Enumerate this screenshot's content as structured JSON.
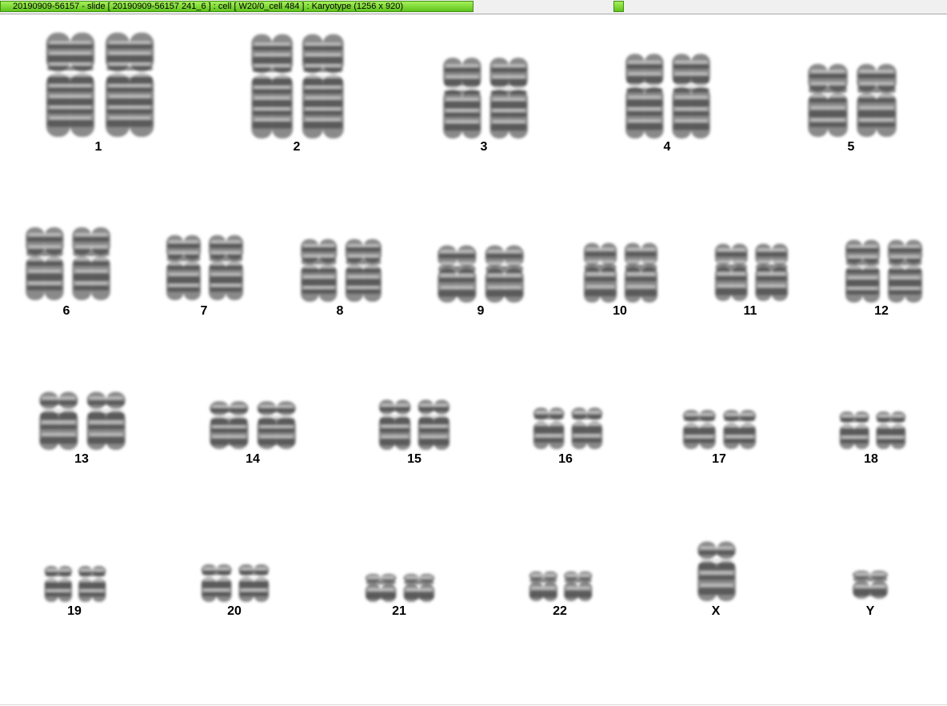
{
  "window": {
    "title": "20190909-56157 - slide [ 20190909-56157 241_6 ] : cell [ W20/0_cell 484 ] : Karyotype  (1256 x 920)"
  },
  "karyotype": {
    "chromosomes": [
      {
        "label": "1"
      },
      {
        "label": "2"
      },
      {
        "label": "3"
      },
      {
        "label": "4"
      },
      {
        "label": "5"
      },
      {
        "label": "6"
      },
      {
        "label": "7"
      },
      {
        "label": "8"
      },
      {
        "label": "9"
      },
      {
        "label": "10"
      },
      {
        "label": "11"
      },
      {
        "label": "12"
      },
      {
        "label": "13"
      },
      {
        "label": "14"
      },
      {
        "label": "15"
      },
      {
        "label": "16"
      },
      {
        "label": "17"
      },
      {
        "label": "18"
      },
      {
        "label": "19"
      },
      {
        "label": "20"
      },
      {
        "label": "21"
      },
      {
        "label": "22"
      },
      {
        "label": "X"
      },
      {
        "label": "Y"
      }
    ]
  }
}
